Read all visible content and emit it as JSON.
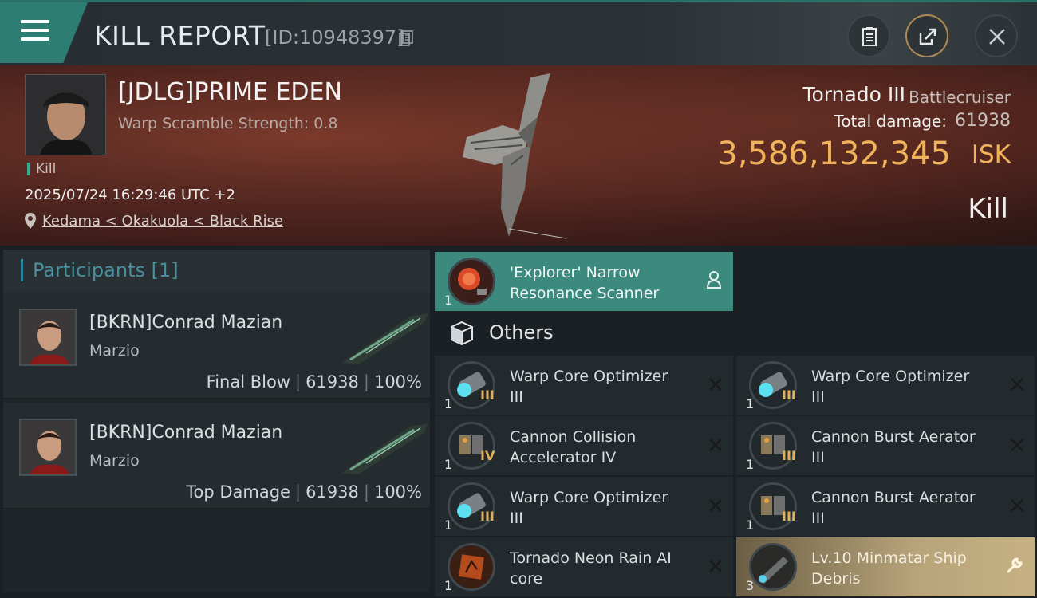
{
  "header": {
    "title": "KILL REPORT",
    "report_id": "[ID:10948397]"
  },
  "victim": {
    "name": "[JDLG]PRIME EDEN",
    "warp_scramble": "Warp Scramble Strength: 0.8",
    "kill_tag": "Kill",
    "datetime": "2025/07/24 16:29:46 UTC +2",
    "location": "Kedama < Okakuola < Black Rise",
    "ship_name": "Tornado III",
    "ship_class": "Battlecruiser",
    "total_damage_label": "Total damage:",
    "total_damage": "61938",
    "isk_value": "3,586,132,345",
    "isk_unit": "ISK",
    "result": "Kill"
  },
  "participants": {
    "title": "Participants [1]",
    "items": [
      {
        "name": "[BKRN]Conrad Mazian",
        "corp": "Marzio",
        "role": "Final Blow",
        "damage": "61938",
        "percent": "100%"
      },
      {
        "name": "[BKRN]Conrad Mazian",
        "corp": "Marzio",
        "role": "Top Damage",
        "damage": "61938",
        "percent": "100%"
      }
    ]
  },
  "highlighted_item": {
    "name": "'Explorer' Narrow Resonance Scanner",
    "qty": "1"
  },
  "others": {
    "label": "Others",
    "items": [
      {
        "name": "Warp Core Optimizer III",
        "qty": "1",
        "tier": "III",
        "status": "destroyed"
      },
      {
        "name": "Warp Core Optimizer III",
        "qty": "1",
        "tier": "III",
        "status": "destroyed"
      },
      {
        "name": "Cannon Collision Accelerator IV",
        "qty": "1",
        "tier": "IV",
        "status": "destroyed"
      },
      {
        "name": "Cannon Burst Aerator III",
        "qty": "1",
        "tier": "III",
        "status": "destroyed"
      },
      {
        "name": "Warp Core Optimizer III",
        "qty": "1",
        "tier": "III",
        "status": "destroyed"
      },
      {
        "name": "Cannon Burst Aerator III",
        "qty": "1",
        "tier": "III",
        "status": "destroyed"
      },
      {
        "name": "Tornado Neon Rain AI core",
        "qty": "1",
        "tier": "",
        "status": "destroyed"
      },
      {
        "name": "Lv.10 Minmatar Ship Debris",
        "qty": "3",
        "tier": "",
        "status": "dropped"
      }
    ]
  },
  "colors": {
    "accent_teal": "#2e7d73",
    "isk_gold": "#f0b35a",
    "dropped_gold": "#b8a47a"
  }
}
